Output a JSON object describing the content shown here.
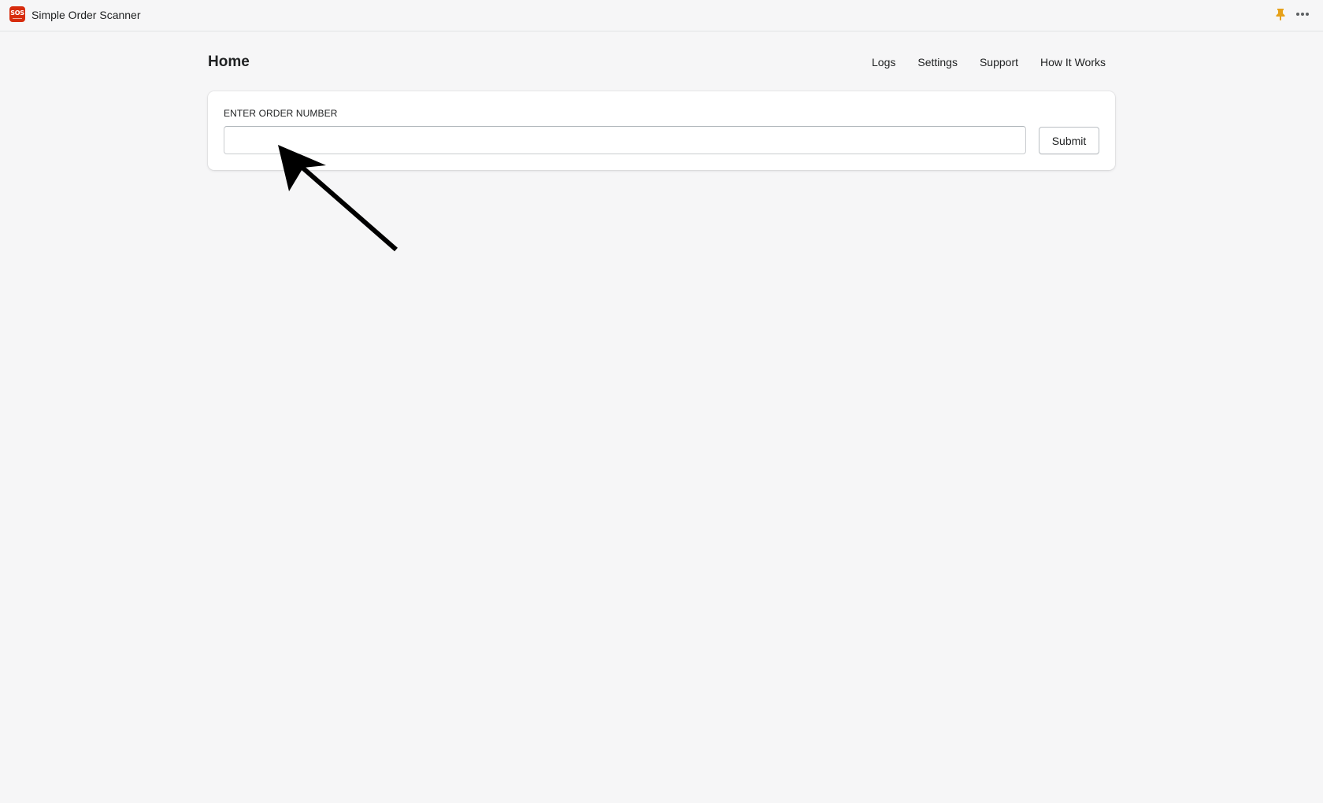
{
  "app_bar": {
    "logo_text": "SOS",
    "title": "Simple Order Scanner",
    "pin_icon": "pin-icon",
    "more_icon": "more-horizontal-icon"
  },
  "page": {
    "title": "Home",
    "nav": {
      "logs": "Logs",
      "settings": "Settings",
      "support": "Support",
      "how_it_works": "How It Works"
    }
  },
  "order_form": {
    "label": "ENTER ORDER NUMBER",
    "input_value": "",
    "submit_label": "Submit"
  },
  "annotation": {
    "icon": "arrow-annotation-icon"
  },
  "colors": {
    "brand": "#d72c0d",
    "pin": "#e6a11a",
    "background": "#f6f6f7",
    "card": "#ffffff",
    "text": "#202223"
  }
}
